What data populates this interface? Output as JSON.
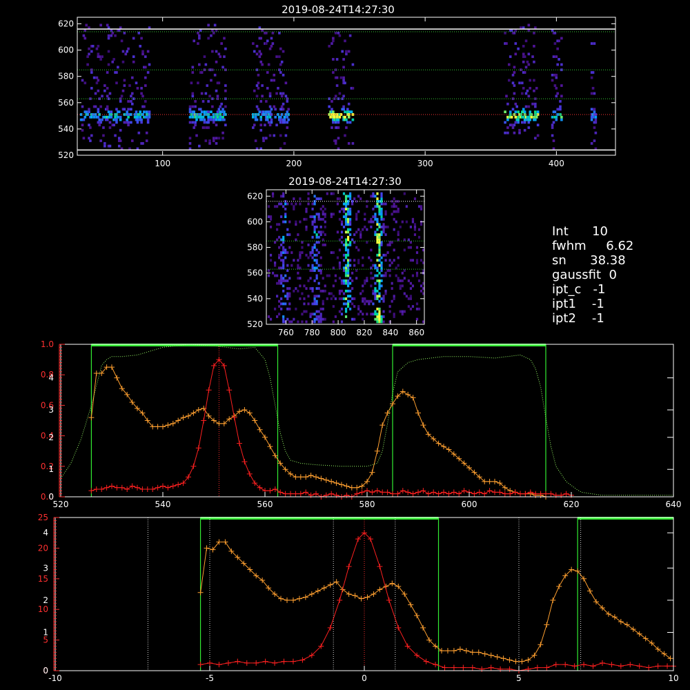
{
  "chart_data": [
    {
      "id": "top",
      "type": "heatmap",
      "title": "2019-08-24T14:27:30",
      "xlim": [
        35,
        445
      ],
      "ylim": [
        520,
        625
      ],
      "xticks": [
        100,
        200,
        300,
        400
      ],
      "yticks": [
        520,
        540,
        560,
        580,
        600,
        620
      ],
      "guide_lines": [
        {
          "y": 524,
          "color": "#ffffff"
        },
        {
          "y": 616,
          "color": "#ffffff"
        },
        {
          "y": 585,
          "color": "#33cc33"
        },
        {
          "y": 563,
          "color": "#33cc33"
        },
        {
          "y": 551,
          "color": "#ff3333"
        },
        {
          "y": 614,
          "color": "#33cc33"
        }
      ],
      "columns": [
        {
          "x0": 37,
          "x1": 90,
          "peak": 0.5
        },
        {
          "x0": 120,
          "x1": 148,
          "peak": 0.55
        },
        {
          "x0": 168,
          "x1": 196,
          "peak": 0.45
        },
        {
          "x0": 226,
          "x1": 245,
          "peak": 0.95
        },
        {
          "x0": 360,
          "x1": 386,
          "peak": 0.8
        },
        {
          "x0": 396,
          "x1": 404,
          "peak": 0.7
        },
        {
          "x0": 426,
          "x1": 430,
          "peak": 0.35
        }
      ]
    },
    {
      "id": "middle",
      "type": "heatmap",
      "title": "2019-08-24T14:27:30",
      "xlim": [
        745,
        866
      ],
      "ylim": [
        520,
        625
      ],
      "xticks": [
        760,
        780,
        800,
        820,
        840,
        860
      ],
      "yticks": [
        520,
        540,
        560,
        580,
        600,
        620
      ],
      "guide_lines": [
        {
          "y": 563,
          "color": "#33cc33"
        },
        {
          "y": 585,
          "color": "#33cc33"
        },
        {
          "y": 616,
          "color": "#ffffff"
        }
      ],
      "streaks": [
        {
          "x": 758,
          "peak": 0.4
        },
        {
          "x": 782,
          "peak": 0.45
        },
        {
          "x": 806,
          "peak": 0.85
        },
        {
          "x": 830,
          "peak": 0.95
        }
      ]
    },
    {
      "id": "spectrum",
      "type": "line",
      "xlim": [
        520,
        640
      ],
      "ylim": [
        0,
        1
      ],
      "xticks": [
        520,
        540,
        560,
        580,
        600,
        620,
        640
      ],
      "yticks_left_red": [
        {
          "value": 0.0,
          "label": "0.0"
        },
        {
          "value": 0.2,
          "label": "0.2"
        },
        {
          "value": 0.4,
          "label": "0.4"
        },
        {
          "value": 0.6,
          "label": "0.6"
        },
        {
          "value": 0.8,
          "label": "0.8"
        },
        {
          "value": 1.0,
          "label": "1.0"
        }
      ],
      "yticks_left_white": [
        {
          "value": 0.0,
          "label": "0"
        },
        {
          "value": 0.18,
          "label": "1"
        },
        {
          "value": 0.39,
          "label": "2"
        },
        {
          "value": 0.57,
          "label": "3"
        },
        {
          "value": 0.78,
          "label": "4"
        }
      ],
      "top_bars": [
        [
          526,
          562.5
        ],
        [
          585,
          615
        ]
      ],
      "vertical_lines": [
        526,
        562.5,
        585,
        615
      ],
      "center_line": 551,
      "series": [
        {
          "color": "#ffa030",
          "markers": true,
          "x": [
            526,
            527,
            528,
            529,
            530,
            531,
            532,
            533,
            534,
            535,
            536,
            537,
            538,
            539,
            540,
            541,
            542,
            543,
            544,
            545,
            546,
            547,
            548,
            549,
            550,
            551,
            552,
            553,
            554,
            555,
            556,
            557,
            558,
            559,
            560,
            561,
            562,
            563,
            564,
            565,
            566,
            567,
            568,
            569,
            570,
            571,
            572,
            573,
            574,
            575,
            576,
            577,
            578,
            579,
            580,
            581,
            582,
            583,
            584,
            585,
            586,
            587,
            588,
            589,
            590,
            591,
            592,
            593,
            594,
            595,
            596,
            597,
            598,
            599,
            600,
            601,
            602,
            603,
            604,
            605,
            606,
            607,
            608,
            609,
            610,
            611,
            612,
            613,
            614,
            615
          ],
          "y": [
            0.52,
            0.81,
            0.81,
            0.85,
            0.85,
            0.78,
            0.71,
            0.67,
            0.62,
            0.58,
            0.55,
            0.5,
            0.46,
            0.46,
            0.46,
            0.47,
            0.48,
            0.5,
            0.52,
            0.53,
            0.55,
            0.57,
            0.58,
            0.53,
            0.5,
            0.48,
            0.48,
            0.51,
            0.53,
            0.56,
            0.57,
            0.55,
            0.5,
            0.44,
            0.39,
            0.33,
            0.27,
            0.22,
            0.18,
            0.15,
            0.13,
            0.13,
            0.13,
            0.14,
            0.13,
            0.12,
            0.11,
            0.1,
            0.09,
            0.08,
            0.07,
            0.06,
            0.06,
            0.07,
            0.1,
            0.16,
            0.3,
            0.47,
            0.55,
            0.61,
            0.66,
            0.69,
            0.67,
            0.65,
            0.55,
            0.47,
            0.41,
            0.38,
            0.35,
            0.33,
            0.31,
            0.28,
            0.25,
            0.22,
            0.19,
            0.16,
            0.13,
            0.1,
            0.1,
            0.1,
            0.09,
            0.06,
            0.04,
            0.03,
            0.02,
            0.02,
            0.02,
            0.01,
            0.01,
            0.0
          ]
        },
        {
          "color": "#ff2020",
          "markers": true,
          "x": [
            526,
            527,
            528,
            529,
            530,
            531,
            532,
            533,
            534,
            535,
            536,
            537,
            538,
            539,
            540,
            541,
            542,
            543,
            544,
            545,
            546,
            547,
            548,
            549,
            550,
            551,
            552,
            553,
            554,
            555,
            556,
            557,
            558,
            559,
            560,
            561,
            562,
            563,
            564,
            565,
            566,
            567,
            568,
            569,
            570,
            571,
            572,
            573,
            574,
            575,
            576,
            577,
            578,
            579,
            580,
            581,
            582,
            583,
            584,
            585,
            586,
            587,
            588,
            589,
            590,
            591,
            592,
            593,
            594,
            595,
            596,
            597,
            598,
            599,
            600,
            601,
            602,
            603,
            604,
            605,
            606,
            607,
            608,
            609,
            610,
            611,
            612,
            613,
            614,
            615,
            616,
            617,
            618,
            619,
            620
          ],
          "y": [
            0.04,
            0.05,
            0.05,
            0.06,
            0.07,
            0.06,
            0.06,
            0.05,
            0.07,
            0.06,
            0.05,
            0.05,
            0.05,
            0.06,
            0.07,
            0.06,
            0.07,
            0.08,
            0.09,
            0.13,
            0.2,
            0.32,
            0.5,
            0.7,
            0.86,
            0.9,
            0.86,
            0.7,
            0.52,
            0.35,
            0.23,
            0.15,
            0.09,
            0.06,
            0.04,
            0.04,
            0.05,
            0.03,
            0.02,
            0.02,
            0.02,
            0.02,
            0.03,
            0.01,
            0.02,
            0.0,
            0.01,
            0.02,
            0.01,
            0.0,
            0.01,
            0.0,
            0.02,
            0.03,
            0.04,
            0.03,
            0.04,
            0.03,
            0.03,
            0.02,
            0.02,
            0.04,
            0.03,
            0.02,
            0.03,
            0.04,
            0.02,
            0.03,
            0.02,
            0.03,
            0.02,
            0.03,
            0.02,
            0.04,
            0.03,
            0.02,
            0.03,
            0.02,
            0.04,
            0.03,
            0.03,
            0.02,
            0.02,
            0.03,
            0.02,
            0.02,
            0.03,
            0.02,
            0.02,
            0.02,
            0.02,
            0.01,
            0.01,
            0.02,
            0.01
          ]
        },
        {
          "color": "#99ff66",
          "markers": false,
          "dotted": true,
          "x": [
            520,
            522,
            524,
            526,
            528,
            529,
            530,
            532,
            535,
            540,
            545,
            550,
            555,
            558,
            560,
            561,
            562,
            563,
            564,
            565,
            567,
            570,
            575,
            580,
            582,
            583,
            584,
            585,
            586,
            588,
            590,
            595,
            600,
            605,
            610,
            612,
            613,
            614,
            615,
            616,
            617,
            619,
            621,
            622,
            624,
            626,
            630,
            635,
            640
          ],
          "y": [
            0.12,
            0.22,
            0.38,
            0.6,
            0.86,
            0.9,
            0.92,
            0.92,
            0.93,
            0.98,
            1.0,
            0.99,
            0.97,
            0.98,
            0.9,
            0.78,
            0.6,
            0.42,
            0.3,
            0.24,
            0.22,
            0.21,
            0.2,
            0.2,
            0.22,
            0.3,
            0.48,
            0.68,
            0.82,
            0.88,
            0.9,
            0.92,
            0.92,
            0.91,
            0.93,
            0.9,
            0.84,
            0.72,
            0.52,
            0.33,
            0.2,
            0.1,
            0.05,
            0.03,
            0.02,
            0.01,
            0.01,
            0.01,
            0.01
          ]
        }
      ]
    },
    {
      "id": "velocity",
      "type": "line",
      "xlim": [
        -10,
        10
      ],
      "ylim": [
        0,
        1
      ],
      "xticks": [
        -10,
        -5,
        0,
        5,
        10
      ],
      "yticks_left_red": [
        {
          "value": 0.0,
          "label": "0"
        },
        {
          "value": 0.2,
          "label": "5"
        },
        {
          "value": 0.4,
          "label": "10"
        },
        {
          "value": 0.6,
          "label": "15"
        },
        {
          "value": 0.8,
          "label": "20"
        },
        {
          "value": 1.0,
          "label": "25"
        }
      ],
      "yticks_left_white": [
        {
          "value": 0.0,
          "label": "0"
        },
        {
          "value": 0.25,
          "label": "1"
        },
        {
          "value": 0.46,
          "label": "2"
        },
        {
          "value": 0.67,
          "label": "3"
        },
        {
          "value": 0.9,
          "label": "4"
        }
      ],
      "top_bars": [
        [
          -5.3,
          2.4
        ],
        [
          6.9,
          10
        ]
      ],
      "vertical_lines_green": [
        -5.3,
        2.4,
        6.9
      ],
      "vertical_lines_dotted": [
        -7,
        -5,
        -1,
        1,
        5,
        7
      ],
      "center_line": 0,
      "series": [
        {
          "color": "#ffa030",
          "markers": true,
          "x": [
            -5.3,
            -5.1,
            -4.9,
            -4.7,
            -4.5,
            -4.3,
            -4.1,
            -3.9,
            -3.7,
            -3.5,
            -3.3,
            -3.1,
            -2.9,
            -2.7,
            -2.5,
            -2.3,
            -2.1,
            -1.9,
            -1.7,
            -1.5,
            -1.3,
            -1.1,
            -0.9,
            -0.7,
            -0.5,
            -0.3,
            -0.1,
            0.1,
            0.3,
            0.5,
            0.7,
            0.9,
            1.1,
            1.3,
            1.5,
            1.7,
            1.9,
            2.1,
            2.3,
            2.5,
            2.7,
            2.9,
            3.1,
            3.3,
            3.5,
            3.7,
            3.9,
            4.1,
            4.3,
            4.5,
            4.7,
            4.9,
            5.1,
            5.3,
            5.5,
            5.7,
            5.9,
            6.1,
            6.3,
            6.5,
            6.7,
            6.9,
            7.1,
            7.3,
            7.5,
            7.7,
            7.9,
            8.1,
            8.3,
            8.5,
            8.7,
            8.9,
            9.1,
            9.3,
            9.5,
            9.7,
            9.9
          ],
          "y": [
            0.51,
            0.8,
            0.79,
            0.84,
            0.84,
            0.78,
            0.74,
            0.7,
            0.66,
            0.62,
            0.59,
            0.54,
            0.5,
            0.47,
            0.46,
            0.46,
            0.47,
            0.48,
            0.5,
            0.52,
            0.54,
            0.56,
            0.58,
            0.53,
            0.5,
            0.49,
            0.47,
            0.48,
            0.5,
            0.53,
            0.55,
            0.57,
            0.55,
            0.5,
            0.43,
            0.36,
            0.28,
            0.2,
            0.16,
            0.13,
            0.13,
            0.13,
            0.14,
            0.13,
            0.12,
            0.12,
            0.11,
            0.1,
            0.09,
            0.08,
            0.07,
            0.06,
            0.06,
            0.07,
            0.1,
            0.17,
            0.3,
            0.46,
            0.55,
            0.62,
            0.66,
            0.65,
            0.6,
            0.52,
            0.45,
            0.41,
            0.37,
            0.35,
            0.32,
            0.3,
            0.27,
            0.24,
            0.21,
            0.18,
            0.14,
            0.11,
            0.08
          ]
        },
        {
          "color": "#ff2020",
          "markers": true,
          "x": [
            -5.3,
            -5.0,
            -4.7,
            -4.4,
            -4.1,
            -3.8,
            -3.5,
            -3.2,
            -2.9,
            -2.6,
            -2.3,
            -2.0,
            -1.7,
            -1.4,
            -1.1,
            -0.8,
            -0.5,
            -0.2,
            0.0,
            0.2,
            0.5,
            0.8,
            1.1,
            1.4,
            1.7,
            2.0,
            2.3,
            2.6,
            2.9,
            3.2,
            3.5,
            3.8,
            4.1,
            4.4,
            4.7,
            5.0,
            5.3,
            5.6,
            5.9,
            6.2,
            6.5,
            6.8,
            7.1,
            7.4,
            7.7,
            8.0,
            8.3,
            8.6,
            8.9,
            9.2,
            9.5,
            9.8,
            10.0
          ],
          "y": [
            0.04,
            0.05,
            0.04,
            0.05,
            0.06,
            0.05,
            0.05,
            0.06,
            0.05,
            0.06,
            0.06,
            0.07,
            0.1,
            0.16,
            0.28,
            0.46,
            0.68,
            0.86,
            0.9,
            0.86,
            0.68,
            0.46,
            0.28,
            0.16,
            0.1,
            0.06,
            0.04,
            0.02,
            0.02,
            0.02,
            0.02,
            0.01,
            0.02,
            0.01,
            0.01,
            0.0,
            0.01,
            0.02,
            0.02,
            0.04,
            0.04,
            0.03,
            0.04,
            0.03,
            0.05,
            0.04,
            0.03,
            0.04,
            0.03,
            0.02,
            0.03,
            0.03,
            0.03
          ]
        }
      ]
    }
  ],
  "info_panel": {
    "lines": [
      "Int      10",
      "fwhm     6.62",
      "sn      38.38",
      "gaussfit  0",
      "ipt_c   -1",
      "ipt1    -1",
      "ipt2    -1"
    ]
  }
}
